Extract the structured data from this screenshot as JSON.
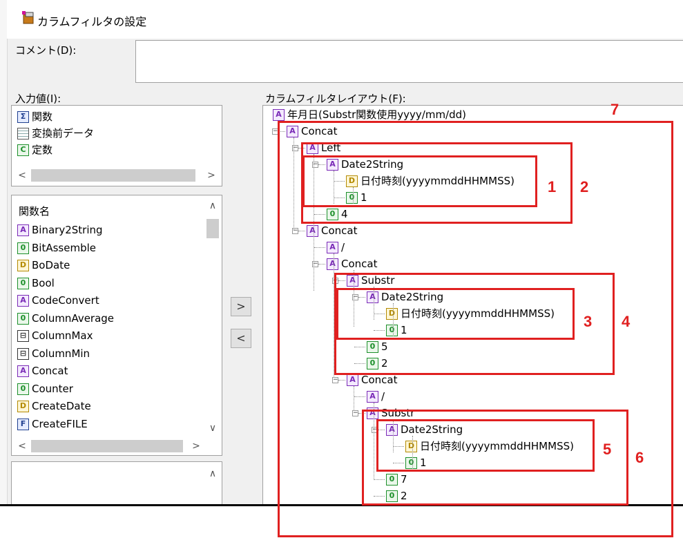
{
  "window": {
    "title": "カラムフィルタの設定"
  },
  "comment": {
    "label": "コメント(D):",
    "value": ""
  },
  "input": {
    "label": "入力値(I):",
    "items": [
      {
        "icon": "function-icon",
        "label": "関数"
      },
      {
        "icon": "table-icon",
        "label": "変換前データ"
      },
      {
        "icon": "constant-icon",
        "label": "定数"
      }
    ]
  },
  "functions": {
    "header": "関数名",
    "items": [
      {
        "icon": "function-string-icon",
        "glyph": "A",
        "label": "Binary2String"
      },
      {
        "icon": "function-number-icon",
        "glyph": "0",
        "label": "BitAssemble"
      },
      {
        "icon": "function-date-icon",
        "glyph": "D",
        "label": "BoDate"
      },
      {
        "icon": "function-number-icon",
        "glyph": "0",
        "label": "Bool"
      },
      {
        "icon": "function-string-icon",
        "glyph": "A",
        "label": "CodeConvert"
      },
      {
        "icon": "function-number-icon",
        "glyph": "0",
        "label": "ColumnAverage"
      },
      {
        "icon": "function-table-icon",
        "glyph": "⊟",
        "label": "ColumnMax"
      },
      {
        "icon": "function-table-icon",
        "glyph": "⊟",
        "label": "ColumnMin"
      },
      {
        "icon": "function-string-icon",
        "glyph": "A",
        "label": "Concat"
      },
      {
        "icon": "function-number-icon",
        "glyph": "0",
        "label": "Counter"
      },
      {
        "icon": "function-date-icon",
        "glyph": "D",
        "label": "CreateDate"
      },
      {
        "icon": "function-file-icon",
        "glyph": "F",
        "label": "CreateFILE"
      }
    ]
  },
  "buttons": {
    "add": ">",
    "remove": "<"
  },
  "layout": {
    "label": "カラムフィルタレイアウト(F):",
    "root": "年月日(Substr関数使用yyyy/mm/dd)",
    "nodes": {
      "concat1": "Concat",
      "left": "Left",
      "d2s1": "Date2String",
      "date1": "日付時刻(yyyymmddHHMMSS)",
      "c1": "1",
      "c4": "4",
      "concat2": "Concat",
      "slash1": "/",
      "concat3": "Concat",
      "substr1": "Substr",
      "d2s2": "Date2String",
      "date2": "日付時刻(yyyymmddHHMMSS)",
      "c1b": "1",
      "c5": "5",
      "c2": "2",
      "concat4": "Concat",
      "slash2": "/",
      "substr2": "Substr",
      "d2s3": "Date2String",
      "date3": "日付時刻(yyyymmddHHMMSS)",
      "c1c": "1",
      "c7": "7",
      "c2b": "2"
    }
  },
  "annotations": [
    "1",
    "2",
    "3",
    "4",
    "5",
    "6",
    "7"
  ],
  "colors": {
    "annotation": "#e02020"
  }
}
